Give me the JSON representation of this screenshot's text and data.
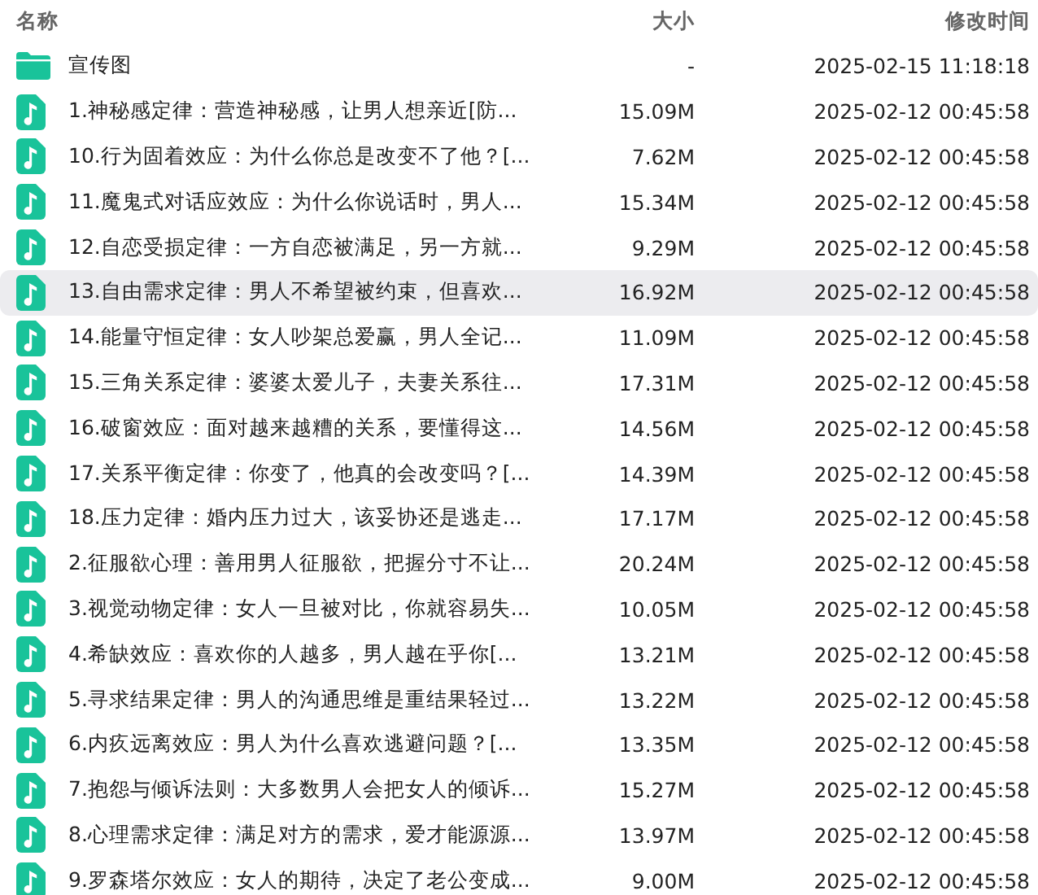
{
  "columns": [
    "名称",
    "大小",
    "修改时间"
  ],
  "rows": [
    {
      "kind": "folder",
      "name": "宣传图",
      "size": "-",
      "modified": "2025-02-15 11:18:18",
      "hovered": false
    },
    {
      "kind": "audio",
      "name": "1.神秘感定律：营造神秘感，让男人想亲近[防...",
      "size": "15.09M",
      "modified": "2025-02-12 00:45:58",
      "hovered": false
    },
    {
      "kind": "audio",
      "name": "10.行为固着效应：为什么你总是改变不了他？[...",
      "size": "7.62M",
      "modified": "2025-02-12 00:45:58",
      "hovered": false
    },
    {
      "kind": "audio",
      "name": "11.魔鬼式对话应效应：为什么你说话时，男人...",
      "size": "15.34M",
      "modified": "2025-02-12 00:45:58",
      "hovered": false
    },
    {
      "kind": "audio",
      "name": "12.自恋受损定律：一方自恋被满足，另一方就...",
      "size": "9.29M",
      "modified": "2025-02-12 00:45:58",
      "hovered": false
    },
    {
      "kind": "audio",
      "name": "13.自由需求定律：男人不希望被约束，但喜欢...",
      "size": "16.92M",
      "modified": "2025-02-12 00:45:58",
      "hovered": true
    },
    {
      "kind": "audio",
      "name": "14.能量守恒定律：女人吵架总爱赢，男人全记...",
      "size": "11.09M",
      "modified": "2025-02-12 00:45:58",
      "hovered": false
    },
    {
      "kind": "audio",
      "name": "15.三角关系定律：婆婆太爱儿子，夫妻关系往...",
      "size": "17.31M",
      "modified": "2025-02-12 00:45:58",
      "hovered": false
    },
    {
      "kind": "audio",
      "name": "16.破窗效应：面对越来越糟的关系，要懂得这...",
      "size": "14.56M",
      "modified": "2025-02-12 00:45:58",
      "hovered": false
    },
    {
      "kind": "audio",
      "name": "17.关系平衡定律：你变了，他真的会改变吗？[...",
      "size": "14.39M",
      "modified": "2025-02-12 00:45:58",
      "hovered": false
    },
    {
      "kind": "audio",
      "name": "18.压力定律：婚内压力过大，该妥协还是逃走...",
      "size": "17.17M",
      "modified": "2025-02-12 00:45:58",
      "hovered": false
    },
    {
      "kind": "audio",
      "name": "2.征服欲心理：善用男人征服欲，把握分寸不让...",
      "size": "20.24M",
      "modified": "2025-02-12 00:45:58",
      "hovered": false
    },
    {
      "kind": "audio",
      "name": "3.视觉动物定律：女人一旦被对比，你就容易失...",
      "size": "10.05M",
      "modified": "2025-02-12 00:45:58",
      "hovered": false
    },
    {
      "kind": "audio",
      "name": "4.希缺效应：喜欢你的人越多，男人越在乎你[...",
      "size": "13.21M",
      "modified": "2025-02-12 00:45:58",
      "hovered": false
    },
    {
      "kind": "audio",
      "name": "5.寻求结果定律：男人的沟通思维是重结果轻过...",
      "size": "13.22M",
      "modified": "2025-02-12 00:45:58",
      "hovered": false
    },
    {
      "kind": "audio",
      "name": "6.内疚远离效应：男人为什么喜欢逃避问题？[...",
      "size": "13.35M",
      "modified": "2025-02-12 00:45:58",
      "hovered": false
    },
    {
      "kind": "audio",
      "name": "7.抱怨与倾诉法则：大多数男人会把女人的倾诉...",
      "size": "15.27M",
      "modified": "2025-02-12 00:45:58",
      "hovered": false
    },
    {
      "kind": "audio",
      "name": "8.心理需求定律：满足对方的需求，爱才能源源...",
      "size": "13.97M",
      "modified": "2025-02-12 00:45:58",
      "hovered": false
    },
    {
      "kind": "audio",
      "name": "9.罗森塔尔效应：女人的期待，决定了老公变成...",
      "size": "9.00M",
      "modified": "2025-02-12 00:45:58",
      "hovered": false
    }
  ]
}
